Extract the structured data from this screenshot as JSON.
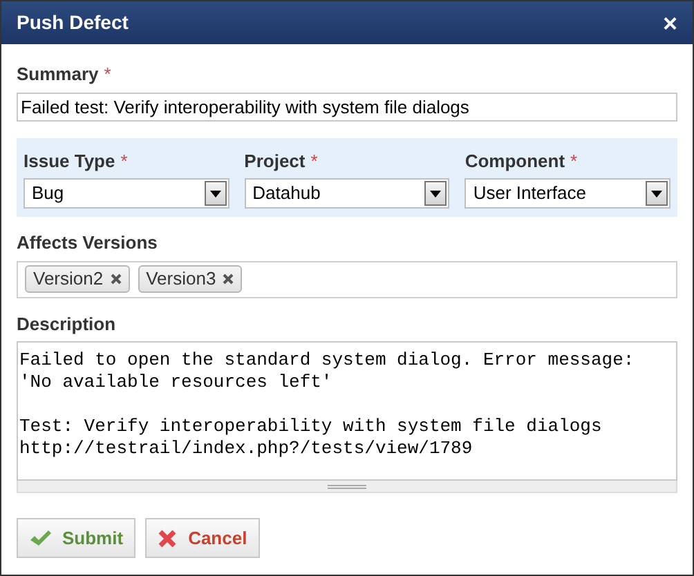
{
  "dialog": {
    "title": "Push Defect",
    "close": "×"
  },
  "summary": {
    "label": "Summary",
    "required": "*",
    "value": "Failed test: Verify interoperability with system file dialogs"
  },
  "selects": [
    {
      "label": "Issue Type",
      "required": "*",
      "value": "Bug"
    },
    {
      "label": "Project",
      "required": "*",
      "value": "Datahub"
    },
    {
      "label": "Component",
      "required": "*",
      "value": "User Interface"
    }
  ],
  "affects_versions": {
    "label": "Affects Versions",
    "tags": [
      "Version2",
      "Version3"
    ]
  },
  "description": {
    "label": "Description",
    "value": "Failed to open the standard system dialog. Error message:\n'No available resources left'\n\nTest: Verify interoperability with system file dialogs\nhttp://testrail/index.php?/tests/view/1789"
  },
  "buttons": [
    {
      "kind": "submit",
      "label": "Submit"
    },
    {
      "kind": "cancel",
      "label": "Cancel"
    }
  ]
}
